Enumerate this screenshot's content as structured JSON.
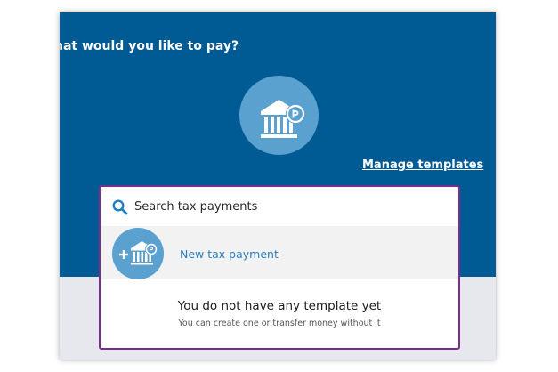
{
  "header": {
    "question": "hat would you like to pay?",
    "manage_templates": "Manage templates"
  },
  "icons": {
    "hero": "bank-building-with-coin-icon",
    "search": "search-icon",
    "new_payment": "add-bank-payment-icon"
  },
  "search": {
    "placeholder": "Search tax payments",
    "value": ""
  },
  "new_payment": {
    "label": "New tax payment"
  },
  "empty_state": {
    "title": "You do not have any template yet",
    "subtitle": "You can create one or transfer money without it"
  },
  "colors": {
    "hero_background": "#005a93",
    "icon_circle": "#5aa1cf",
    "link": "#2a7fbf",
    "card_border": "#7b2d8e"
  }
}
